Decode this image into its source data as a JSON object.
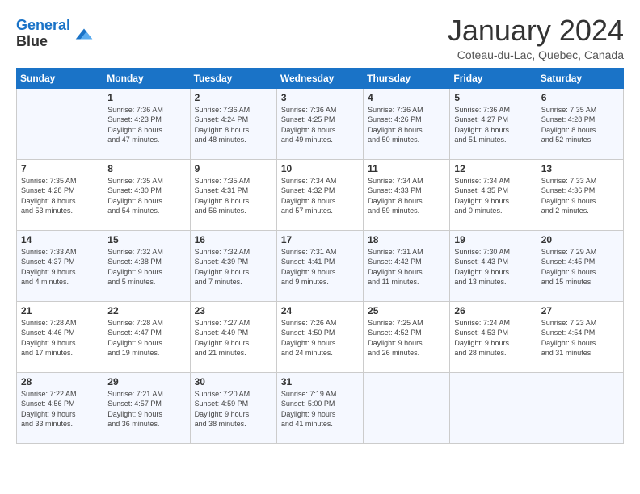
{
  "logo": {
    "line1": "General",
    "line2": "Blue"
  },
  "title": "January 2024",
  "subtitle": "Coteau-du-Lac, Quebec, Canada",
  "days_of_week": [
    "Sunday",
    "Monday",
    "Tuesday",
    "Wednesday",
    "Thursday",
    "Friday",
    "Saturday"
  ],
  "weeks": [
    [
      {
        "day": "",
        "info": ""
      },
      {
        "day": "1",
        "info": "Sunrise: 7:36 AM\nSunset: 4:23 PM\nDaylight: 8 hours\nand 47 minutes."
      },
      {
        "day": "2",
        "info": "Sunrise: 7:36 AM\nSunset: 4:24 PM\nDaylight: 8 hours\nand 48 minutes."
      },
      {
        "day": "3",
        "info": "Sunrise: 7:36 AM\nSunset: 4:25 PM\nDaylight: 8 hours\nand 49 minutes."
      },
      {
        "day": "4",
        "info": "Sunrise: 7:36 AM\nSunset: 4:26 PM\nDaylight: 8 hours\nand 50 minutes."
      },
      {
        "day": "5",
        "info": "Sunrise: 7:36 AM\nSunset: 4:27 PM\nDaylight: 8 hours\nand 51 minutes."
      },
      {
        "day": "6",
        "info": "Sunrise: 7:35 AM\nSunset: 4:28 PM\nDaylight: 8 hours\nand 52 minutes."
      }
    ],
    [
      {
        "day": "7",
        "info": "Sunrise: 7:35 AM\nSunset: 4:28 PM\nDaylight: 8 hours\nand 53 minutes."
      },
      {
        "day": "8",
        "info": "Sunrise: 7:35 AM\nSunset: 4:30 PM\nDaylight: 8 hours\nand 54 minutes."
      },
      {
        "day": "9",
        "info": "Sunrise: 7:35 AM\nSunset: 4:31 PM\nDaylight: 8 hours\nand 56 minutes."
      },
      {
        "day": "10",
        "info": "Sunrise: 7:34 AM\nSunset: 4:32 PM\nDaylight: 8 hours\nand 57 minutes."
      },
      {
        "day": "11",
        "info": "Sunrise: 7:34 AM\nSunset: 4:33 PM\nDaylight: 8 hours\nand 59 minutes."
      },
      {
        "day": "12",
        "info": "Sunrise: 7:34 AM\nSunset: 4:35 PM\nDaylight: 9 hours\nand 0 minutes."
      },
      {
        "day": "13",
        "info": "Sunrise: 7:33 AM\nSunset: 4:36 PM\nDaylight: 9 hours\nand 2 minutes."
      }
    ],
    [
      {
        "day": "14",
        "info": "Sunrise: 7:33 AM\nSunset: 4:37 PM\nDaylight: 9 hours\nand 4 minutes."
      },
      {
        "day": "15",
        "info": "Sunrise: 7:32 AM\nSunset: 4:38 PM\nDaylight: 9 hours\nand 5 minutes."
      },
      {
        "day": "16",
        "info": "Sunrise: 7:32 AM\nSunset: 4:39 PM\nDaylight: 9 hours\nand 7 minutes."
      },
      {
        "day": "17",
        "info": "Sunrise: 7:31 AM\nSunset: 4:41 PM\nDaylight: 9 hours\nand 9 minutes."
      },
      {
        "day": "18",
        "info": "Sunrise: 7:31 AM\nSunset: 4:42 PM\nDaylight: 9 hours\nand 11 minutes."
      },
      {
        "day": "19",
        "info": "Sunrise: 7:30 AM\nSunset: 4:43 PM\nDaylight: 9 hours\nand 13 minutes."
      },
      {
        "day": "20",
        "info": "Sunrise: 7:29 AM\nSunset: 4:45 PM\nDaylight: 9 hours\nand 15 minutes."
      }
    ],
    [
      {
        "day": "21",
        "info": "Sunrise: 7:28 AM\nSunset: 4:46 PM\nDaylight: 9 hours\nand 17 minutes."
      },
      {
        "day": "22",
        "info": "Sunrise: 7:28 AM\nSunset: 4:47 PM\nDaylight: 9 hours\nand 19 minutes."
      },
      {
        "day": "23",
        "info": "Sunrise: 7:27 AM\nSunset: 4:49 PM\nDaylight: 9 hours\nand 21 minutes."
      },
      {
        "day": "24",
        "info": "Sunrise: 7:26 AM\nSunset: 4:50 PM\nDaylight: 9 hours\nand 24 minutes."
      },
      {
        "day": "25",
        "info": "Sunrise: 7:25 AM\nSunset: 4:52 PM\nDaylight: 9 hours\nand 26 minutes."
      },
      {
        "day": "26",
        "info": "Sunrise: 7:24 AM\nSunset: 4:53 PM\nDaylight: 9 hours\nand 28 minutes."
      },
      {
        "day": "27",
        "info": "Sunrise: 7:23 AM\nSunset: 4:54 PM\nDaylight: 9 hours\nand 31 minutes."
      }
    ],
    [
      {
        "day": "28",
        "info": "Sunrise: 7:22 AM\nSunset: 4:56 PM\nDaylight: 9 hours\nand 33 minutes."
      },
      {
        "day": "29",
        "info": "Sunrise: 7:21 AM\nSunset: 4:57 PM\nDaylight: 9 hours\nand 36 minutes."
      },
      {
        "day": "30",
        "info": "Sunrise: 7:20 AM\nSunset: 4:59 PM\nDaylight: 9 hours\nand 38 minutes."
      },
      {
        "day": "31",
        "info": "Sunrise: 7:19 AM\nSunset: 5:00 PM\nDaylight: 9 hours\nand 41 minutes."
      },
      {
        "day": "",
        "info": ""
      },
      {
        "day": "",
        "info": ""
      },
      {
        "day": "",
        "info": ""
      }
    ]
  ]
}
